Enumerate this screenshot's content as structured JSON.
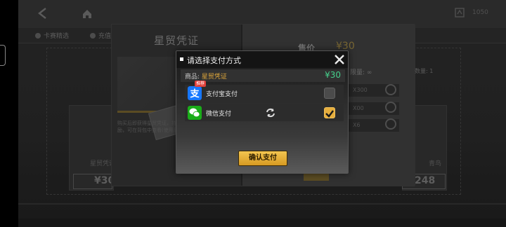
{
  "background": {
    "topbar": {
      "right_text": "1050"
    },
    "subnav": {
      "items": [
        "卡赛精选",
        "充值"
      ]
    },
    "cards": {
      "left_label": "星贸凭证",
      "left_price": "¥30",
      "right_label": "青鸟",
      "right_price": "248"
    },
    "purchase_panel": {
      "product_title": "星贸凭证",
      "product_desc": "购买后即获得星贸凭证，持续30天每日额外获得奖励，可在背包中查看(使用后生效)",
      "price_label": "售价",
      "price_value": "¥30",
      "stock_label": "限量: ∞",
      "owned_label": "数量: 1",
      "qty_options": [
        "X300",
        "X00",
        "X6"
      ]
    }
  },
  "modal": {
    "title": "请选择支付方式",
    "item_prefix": "商品: ",
    "item_name": "星贸凭证",
    "item_price": "¥30",
    "methods": [
      {
        "label": "支付宝支付",
        "badge": "推荐",
        "icon": "alipay-icon",
        "selected": false,
        "color": "#1677ff"
      },
      {
        "label": "微信支付",
        "icon": "wechat-icon",
        "selected": true,
        "color": "#1aad19"
      }
    ],
    "confirm_label": "确认支付"
  },
  "colors": {
    "accent_gold": "#e6ae3d",
    "price_green": "#46d08c",
    "item_gold": "#e2a93b"
  }
}
